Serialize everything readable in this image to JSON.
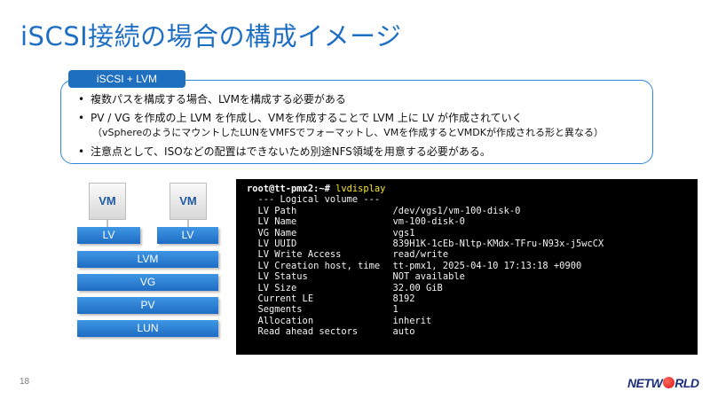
{
  "slide": {
    "title": "iSCSI接続の場合の構成イメージ",
    "tag": "iSCSI + LVM",
    "bullets": [
      "複数パスを構成する場合、LVMを構成する必要がある",
      "PV / VG を作成の上 LVM を作成し、VMを作成することで LVM 上に LV が作成されていく",
      "注意点として、ISOなどの配置はできないため別途NFS領域を用意する必要がある。"
    ],
    "bullet_note": "（vSphereのようにマウントしたLUNをVMFSでフォーマットし、VMを作成するとVMDKが作成される形と異なる）",
    "page_number": "18",
    "logo": {
      "pre": "NETW",
      "post": "RLD"
    }
  },
  "diagram": {
    "vm_labels": [
      "VM",
      "VM"
    ],
    "lv_labels": [
      "LV",
      "LV"
    ],
    "layers": [
      "LVM",
      "VG",
      "PV",
      "LUN"
    ]
  },
  "terminal": {
    "prompt": "root@tt-pmx2:~#",
    "command": "lvdisplay",
    "header": "  --- Logical volume ---",
    "fields": [
      {
        "key": "LV Path",
        "value": "/dev/vgs1/vm-100-disk-0"
      },
      {
        "key": "LV Name",
        "value": "vm-100-disk-0"
      },
      {
        "key": "VG Name",
        "value": "vgs1"
      },
      {
        "key": "LV UUID",
        "value": "839H1K-1cEb-Nltp-KMdx-TFru-N93x-j5wcCX"
      },
      {
        "key": "LV Write Access",
        "value": "read/write"
      },
      {
        "key": "LV Creation host, time",
        "value": "tt-pmx1, 2025-04-10 17:13:18 +0900"
      },
      {
        "key": "LV Status",
        "value": "NOT available"
      },
      {
        "key": "LV Size",
        "value": "32.00 GiB"
      },
      {
        "key": "Current LE",
        "value": "8192"
      },
      {
        "key": "Segments",
        "value": "1"
      },
      {
        "key": "Allocation",
        "value": "inherit"
      },
      {
        "key": "Read ahead sectors",
        "value": "auto"
      }
    ]
  },
  "colors": {
    "title": "#1e6fc4",
    "accent": "#1f6fc0",
    "layer_top": "#3f96e4",
    "layer_bottom": "#1e6cc3",
    "command": "#f5e52c"
  }
}
